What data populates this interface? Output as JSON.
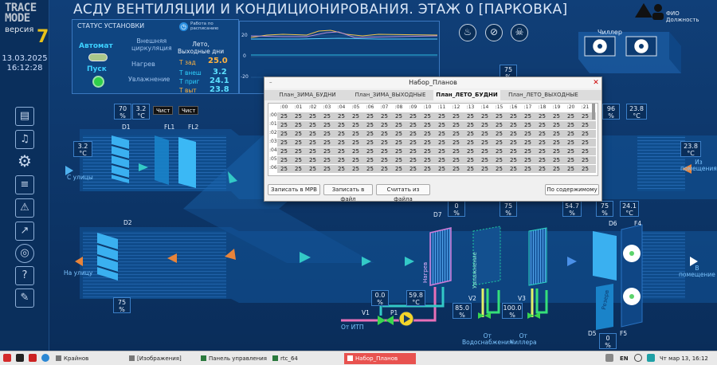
{
  "header": {
    "title": "АСДУ  ВЕНТИЛЯЦИИ  И  КОНДИЦИОНИРОВАНИЯ. ЭТАЖ 0 [ПАРКОВКА]",
    "user_line1": "ФИО",
    "user_line2": "Должность"
  },
  "logo": {
    "line1": "TRACE",
    "line2": "MODE",
    "version_word": "версия",
    "version_num": "7"
  },
  "clock": {
    "date": "13.03.2025",
    "time": "16:12:28"
  },
  "sidebar": [
    "reports-icon",
    "bell-icon",
    "gear-icon",
    "document-icon",
    "alarm-panel-icon",
    "trend-icon",
    "network-icon",
    "help-icon",
    "log-icon"
  ],
  "status": {
    "heading": "СТАТУС УСТАНОВКИ",
    "mode_badge": "Работа по\nрасписанию",
    "auto_label": "Автомат",
    "start_label": "Пуск",
    "ext_circ": "Внешняя\nциркуляция",
    "heating": "Нагрев",
    "humid": "Увлажнение",
    "season": "Лето,\nВыходные дни",
    "t_set_label": "Т зад",
    "t_set_value": "25.0",
    "t_ext_label": "Т внеш",
    "t_ext_value": "3.2",
    "t_in_label": "Т приг",
    "t_in_value": "24.1",
    "t_out_label": "Т выт",
    "t_out_value": "23.8"
  },
  "trend": {
    "y_ticks": [
      "20",
      "0",
      "-20"
    ]
  },
  "schema": {
    "chiller_label": "Чиллер",
    "box_70": "70",
    "box_32a": "3.2",
    "box_32b": "3.2",
    "chip_clean1": "Чист",
    "chip_clean2": "Чист",
    "tag_d1": "D1",
    "tag_fl1": "FL1",
    "tag_fl2": "FL2",
    "tag_d2": "D2",
    "tag_d7": "D7",
    "tag_d6": "D6",
    "tag_f4": "F4",
    "tag_d5": "D5",
    "tag_f5": "F5",
    "from_street": "С улицы",
    "to_street": "На улицу",
    "from_room": "Из\nпомещения",
    "to_room": "В\nпомещение",
    "box_75a": "75",
    "box_75b": "75",
    "box_75c": "75",
    "box_75d": "75",
    "box_75e": "75",
    "box_0a": "0",
    "box_0b": "0",
    "box_547": "54.7",
    "box_241": "24.1",
    "box_238a": "23.8",
    "box_238b": "23.8",
    "box_96": "96",
    "box_00": "0.0",
    "box_598": "59.8",
    "box_850": "85.0",
    "box_1000": "100.0",
    "unit_pct": "%",
    "unit_c": "°C",
    "heater_label": "Нагрев",
    "humid_label": "Увлажнение",
    "from_itp": "От ИТП",
    "from_water": "От\nВодоснабжения",
    "from_chiller": "От\nЧиллера",
    "v1": "V1",
    "p1": "P1",
    "v2": "V2",
    "v3": "V3",
    "rezerv": "Резерв",
    "rezerv2": "Резерв"
  },
  "dialog": {
    "title": "Набор_Планов",
    "tabs": [
      "План_ЗИМА_БУДНИ",
      "План_ЗИМА_ВЫХОДНЫЕ",
      "План_ЛЕТО_БУДНИ",
      "План_ЛЕТО_ВЫХОДНЫЕ"
    ],
    "active_tab": 2,
    "hours": [
      ":00",
      ":01",
      ":02",
      ":03",
      ":04",
      ":05",
      ":06",
      ":07",
      ":08",
      ":09",
      ":10",
      ":11",
      ":12",
      ":13",
      ":14",
      ":15",
      ":16",
      ":17",
      ":18",
      ":19",
      ":20",
      ":21"
    ],
    "rows": [
      ":00",
      ":01",
      ":02",
      ":03",
      ":04",
      ":05",
      ":06"
    ],
    "cell_value": "25",
    "btn_save_mrv": "Записать в МРВ",
    "btn_save_file": "Записать в файл",
    "btn_read_file": "Считать из файла",
    "btn_content": "По содержимому"
  },
  "taskbar": {
    "items": [
      "Крайнов",
      "[Изображения]",
      "Панель управления",
      "rtc_64",
      "Набор_Планов"
    ],
    "lang": "EN",
    "clock": "Чт мар 13, 16:12"
  }
}
